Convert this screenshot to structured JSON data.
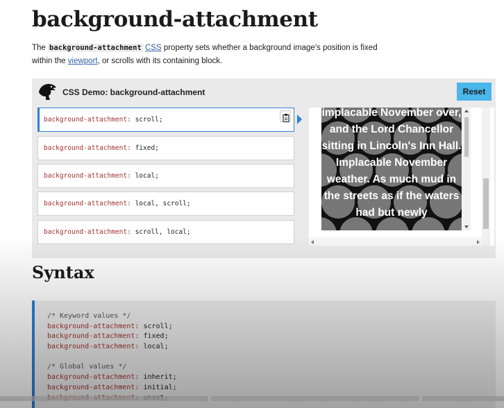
{
  "page": {
    "title": "background-attachment",
    "intro": {
      "before": "The ",
      "code": "background-attachment",
      "css_link": "CSS",
      "middle": " property sets whether a background image's position is fixed within the ",
      "viewport_link": "viewport",
      "after": ", or scrolls with its containing block."
    }
  },
  "demo": {
    "title": "CSS Demo: background-attachment",
    "reset_label": "Reset",
    "choices": [
      {
        "prop": "background-attachment:",
        "value": " scroll;"
      },
      {
        "prop": "background-attachment:",
        "value": " fixed;"
      },
      {
        "prop": "background-attachment:",
        "value": " local;"
      },
      {
        "prop": "background-attachment:",
        "value": " local, scroll;"
      },
      {
        "prop": "background-attachment:",
        "value": " scroll, local;"
      }
    ],
    "output_text": "implacable November over, and the Lord Chancellor sitting in Lincoln's Inn Hall. Implacable November weather. As much mud in the streets as if the waters had but newly"
  },
  "syntax": {
    "title": "Syntax",
    "comment_keywords": "/* Keyword values */",
    "comment_global": "/* Global values */",
    "prop": "background-attachment:",
    "keyword_values": [
      " scroll;",
      " fixed;",
      " local;"
    ],
    "global_values": [
      " inherit;",
      " initial;",
      " unset;"
    ]
  },
  "colors": {
    "accent": "#2f7fd6",
    "reset_button": "#4ab6ea",
    "property": "#a0322e",
    "link": "#3060a8"
  },
  "icons": {
    "logo": "mdn-dinosaur-icon",
    "copy": "clipboard-icon",
    "selected_arrow": "triangle-right-icon"
  }
}
